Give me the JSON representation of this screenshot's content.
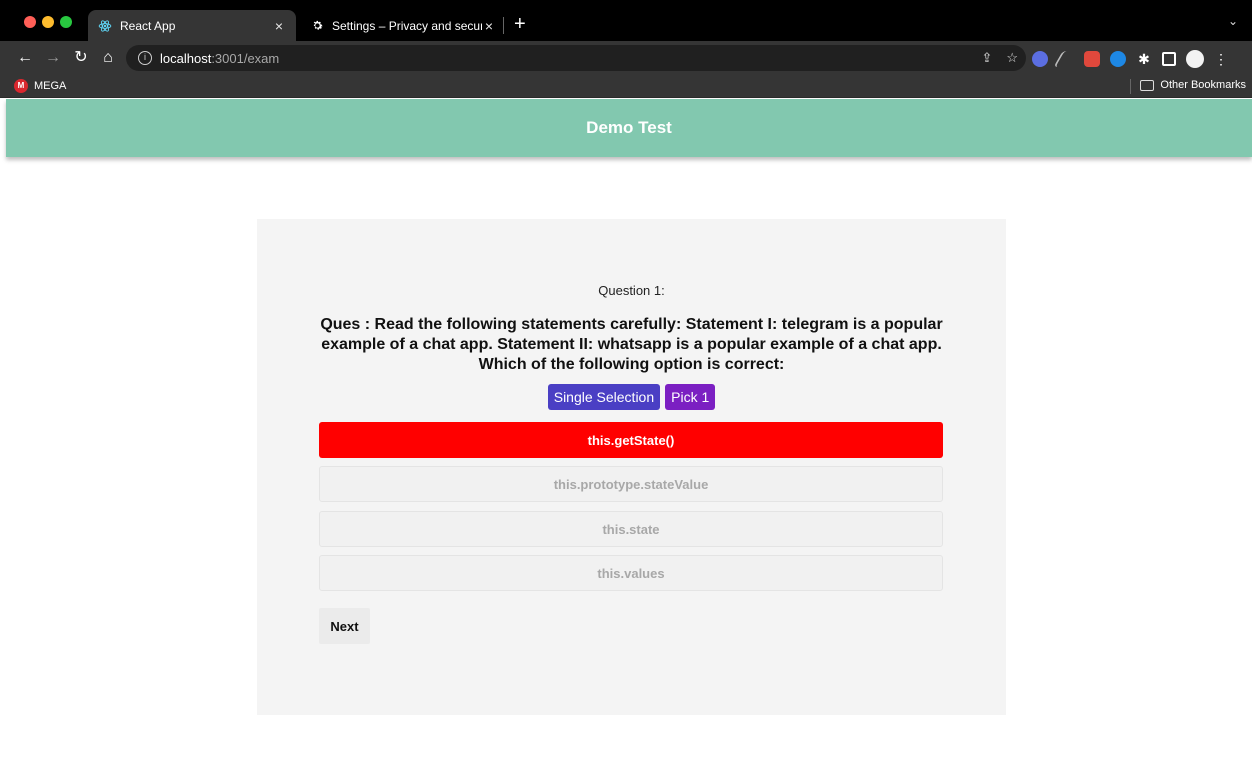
{
  "browser": {
    "tabs": [
      {
        "title": "React App",
        "icon": "react-icon",
        "active": true
      },
      {
        "title": "Settings – Privacy and security",
        "icon": "gear-icon",
        "active": false
      }
    ],
    "new_tab_glyph": "+",
    "close_glyph": "×",
    "address": {
      "host": "localhost",
      "path": ":3001/exam"
    },
    "bookmarks": [
      {
        "label": "MEGA",
        "icon": "mega-icon"
      }
    ],
    "other_bookmarks_label": "Other Bookmarks"
  },
  "app": {
    "title": "Demo Test",
    "header_color": "#82c8af"
  },
  "question": {
    "number_label": "Question 1:",
    "text": "Ques : Read the following statements carefully: Statement I: telegram is a popular example of a chat app. Statement II: whatsapp is a popular example of a chat app. Which of the following option is correct:",
    "tags": {
      "type": "Single Selection",
      "pick": "Pick 1"
    },
    "options": [
      {
        "label": "this.getState()",
        "selected": true
      },
      {
        "label": "this.prototype.stateValue",
        "selected": false
      },
      {
        "label": "this.state",
        "selected": false
      },
      {
        "label": "this.values",
        "selected": false
      }
    ],
    "next_label": "Next"
  },
  "colors": {
    "selected_option": "#ff0000",
    "tag_type": "#4a3fc4",
    "tag_pick": "#7b1fc2"
  }
}
